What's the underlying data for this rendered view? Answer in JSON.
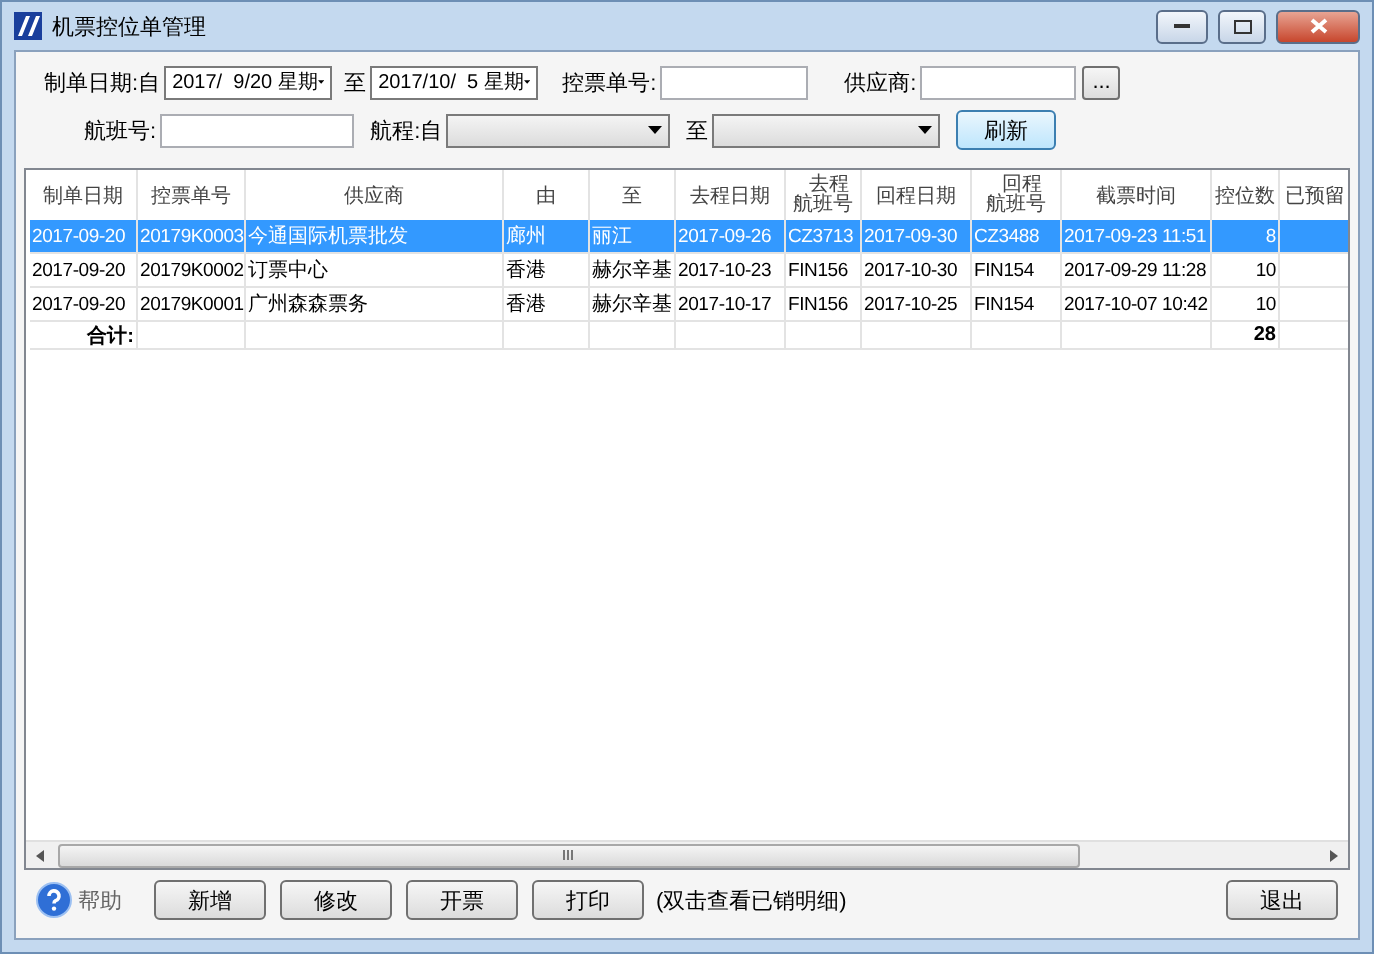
{
  "window": {
    "title": "机票控位单管理"
  },
  "filters": {
    "date_label": "制单日期:自",
    "date_from": "2017/  9/20 星期",
    "date_sep": "至",
    "date_to": "2017/10/  5 星期",
    "ticket_no_label": "控票单号:",
    "supplier_label": "供应商:",
    "supplier_button": "...",
    "flight_label": "航班号:",
    "route_label": "航程:自",
    "route_sep": "至",
    "refresh_button": "刷新"
  },
  "table": {
    "columns": [
      {
        "label": "制单日期",
        "two_line": false
      },
      {
        "label": "控票单号",
        "two_line": false
      },
      {
        "label": "供应商",
        "two_line": false
      },
      {
        "label": "由",
        "two_line": false
      },
      {
        "label": "至",
        "two_line": false
      },
      {
        "label": "去程日期",
        "two_line": false
      },
      {
        "label": "去程航班号",
        "two_line": true
      },
      {
        "label": "回程日期",
        "two_line": false
      },
      {
        "label": "回程航班号",
        "two_line": true
      },
      {
        "label": "截票时间",
        "two_line": false
      },
      {
        "label": "控位数",
        "two_line": false
      },
      {
        "label": "已预留",
        "two_line": false
      }
    ],
    "rows": [
      {
        "selected": true,
        "cells": [
          "2017-09-20",
          "20179K0003",
          "今通国际机票批发",
          "廊州",
          "丽江",
          "2017-09-26",
          "CZ3713",
          "2017-09-30",
          "CZ3488",
          "2017-09-23 11:51",
          "8",
          ""
        ]
      },
      {
        "selected": false,
        "cells": [
          "2017-09-20",
          "20179K0002",
          "订票中心",
          "香港",
          "赫尔辛基",
          "2017-10-23",
          "FIN156",
          "2017-10-30",
          "FIN154",
          "2017-09-29 11:28",
          "10",
          ""
        ]
      },
      {
        "selected": false,
        "cells": [
          "2017-09-20",
          "20179K0001",
          "广州森森票务",
          "香港",
          "赫尔辛基",
          "2017-10-17",
          "FIN156",
          "2017-10-25",
          "FIN154",
          "2017-10-07 10:42",
          "10",
          ""
        ]
      }
    ],
    "total": {
      "label": "合计:",
      "value": "28"
    }
  },
  "footer": {
    "help": "帮助",
    "buttons": [
      "新增",
      "修改",
      "开票",
      "打印"
    ],
    "note": "(双击查看已销明细)",
    "exit": "退出"
  }
}
